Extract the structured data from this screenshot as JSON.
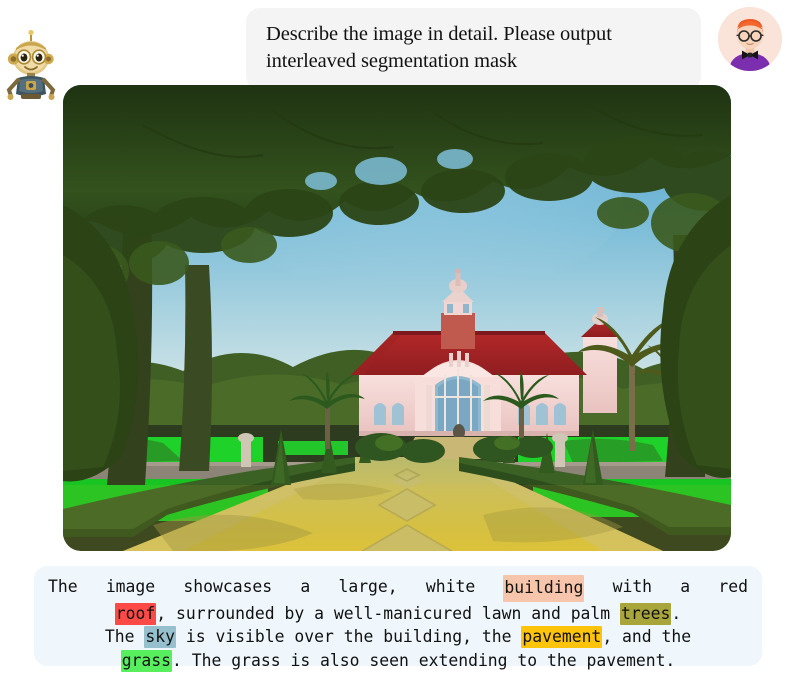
{
  "conversation": {
    "prompt": {
      "speaker": "user",
      "text": "Describe the image in detail. Please output interleaved segmentation mask",
      "line1": "Describe the image in detail. Please output",
      "line2": "interleaved segmentation mask"
    },
    "bot_avatar": {
      "icon": "robot-avatar-icon",
      "alt": "robot assistant avatar"
    },
    "user_avatar": {
      "icon": "person-avatar-icon",
      "alt": "user avatar with glasses and bow tie"
    }
  },
  "image_panel": {
    "alt": "Colonial building with red roof at end of a long paved walkway flanked by lawns and palm trees",
    "segmentation_overlays": [
      {
        "label": "building",
        "color": "#f7c5ab"
      },
      {
        "label": "roof",
        "color": "#fc4a46"
      },
      {
        "label": "trees",
        "color": "#a8a63a"
      },
      {
        "label": "sky",
        "color": "#97c0cf"
      },
      {
        "label": "pavement",
        "color": "#fdc40b"
      },
      {
        "label": "grass",
        "color": "#58ef5e"
      }
    ]
  },
  "answer": {
    "full_text": "The image showcases a large, white building with a red roof, surrounded by a well-manicured lawn and palm trees. The sky is visible over the building, the pavement, and the grass. The grass is also seen extending to the pavement.",
    "lines": [
      {
        "id": 1,
        "segments": [
          {
            "text": "The",
            "highlight": null
          },
          {
            "text": "image",
            "highlight": null
          },
          {
            "text": "showcases",
            "highlight": null
          },
          {
            "text": "a",
            "highlight": null
          },
          {
            "text": "large,",
            "highlight": null
          },
          {
            "text": "white",
            "highlight": null
          },
          {
            "text": "building",
            "highlight": "building"
          },
          {
            "text": "with",
            "highlight": null
          },
          {
            "text": "a",
            "highlight": null
          },
          {
            "text": "red",
            "highlight": null
          }
        ]
      },
      {
        "id": 2,
        "text_before": "",
        "segments": [
          {
            "text": "roof",
            "highlight": "roof"
          },
          {
            "text": ", surrounded by a well-manicured lawn and palm ",
            "highlight": null
          },
          {
            "text": "trees",
            "highlight": "trees"
          },
          {
            "text": ".",
            "highlight": null
          }
        ]
      },
      {
        "id": 3,
        "segments": [
          {
            "text": "The ",
            "highlight": null
          },
          {
            "text": "sky",
            "highlight": "sky"
          },
          {
            "text": " is visible over the building, the ",
            "highlight": null
          },
          {
            "text": "pavement",
            "highlight": "pavement"
          },
          {
            "text": ", and the",
            "highlight": null
          }
        ]
      },
      {
        "id": 4,
        "segments": [
          {
            "text": "grass",
            "highlight": "grass"
          },
          {
            "text": ". The grass is also seen extending to the pavement.",
            "highlight": null
          }
        ]
      }
    ],
    "line1_words": [
      "The",
      "image",
      "showcases",
      "a",
      "large,",
      "white",
      "BUILDING",
      "with",
      "a",
      "red"
    ],
    "highlight_colors": {
      "building": "#f7c5ab",
      "roof": "#fc4a46",
      "trees": "#a8a63a",
      "sky": "#97c0cf",
      "pavement": "#fdc40b",
      "grass": "#58ef5e"
    },
    "bubble_color": "#eff7fc"
  }
}
